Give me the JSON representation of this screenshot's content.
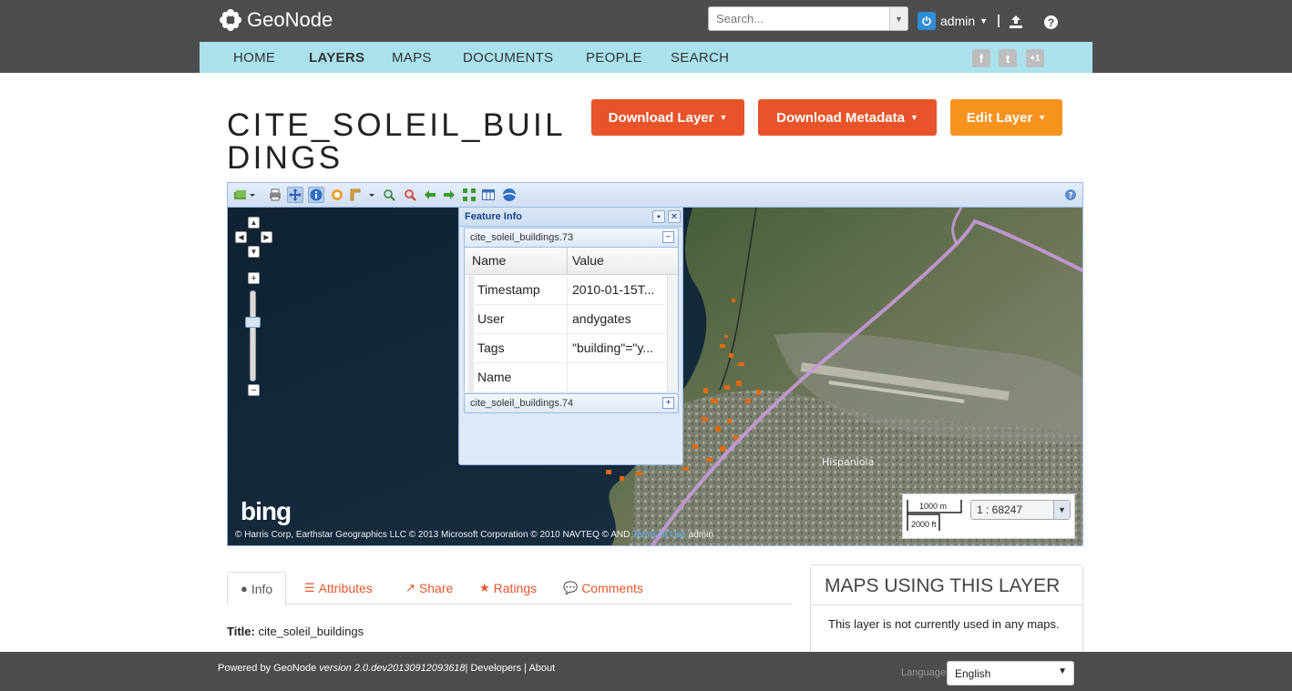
{
  "header": {
    "brand": "GeoNode",
    "search_placeholder": "Search...",
    "user": "admin"
  },
  "nav": [
    "HOME",
    "LAYERS",
    "MAPS",
    "DOCUMENTS",
    "PEOPLE",
    "SEARCH"
  ],
  "nav_active": "LAYERS",
  "social": {
    "facebook": "f",
    "twitter": "t",
    "plusone": "+1"
  },
  "page": {
    "title": "CITE_SOLEIL_BUILDINGS",
    "buttons": {
      "download_layer": "Download Layer",
      "download_metadata": "Download Metadata",
      "edit_layer": "Edit Layer"
    }
  },
  "map": {
    "bing": "bing",
    "attribution": "© Harris Corp, Earthstar Geographics LLC © 2013 Microsoft Corporation © 2010 NAVTEQ © AND",
    "attribution_link": "Terms of Use",
    "attribution_user": "admin",
    "place_label": "Hispaniola",
    "scale_top": "1000 m",
    "scale_bottom": "2000 ft",
    "scale_value": "1 : 68247"
  },
  "feature_info": {
    "title": "Feature Info",
    "group1": "cite_soleil_buildings.73",
    "group2": "cite_soleil_buildings.74",
    "col_name": "Name",
    "col_value": "Value",
    "rows": [
      {
        "name": "Timestamp",
        "value": "2010-01-15T..."
      },
      {
        "name": "User",
        "value": "andygates"
      },
      {
        "name": "Tags",
        "value": "\"building\"=\"y..."
      },
      {
        "name": "Name",
        "value": ""
      }
    ]
  },
  "tabs": {
    "info": "Info",
    "attributes": "Attributes",
    "share": "Share",
    "ratings": "Ratings",
    "comments": "Comments"
  },
  "info": {
    "title_label": "Title:",
    "title_value": "cite_soleil_buildings"
  },
  "side": {
    "heading": "MAPS USING THIS LAYER",
    "body": "This layer is not currently used in any maps."
  },
  "footer": {
    "powered": "Powered by GeoNode",
    "version": "version 2.0.dev20130912093618",
    "links": "| Developers | About",
    "language_label": "Language",
    "language_value": "English"
  }
}
